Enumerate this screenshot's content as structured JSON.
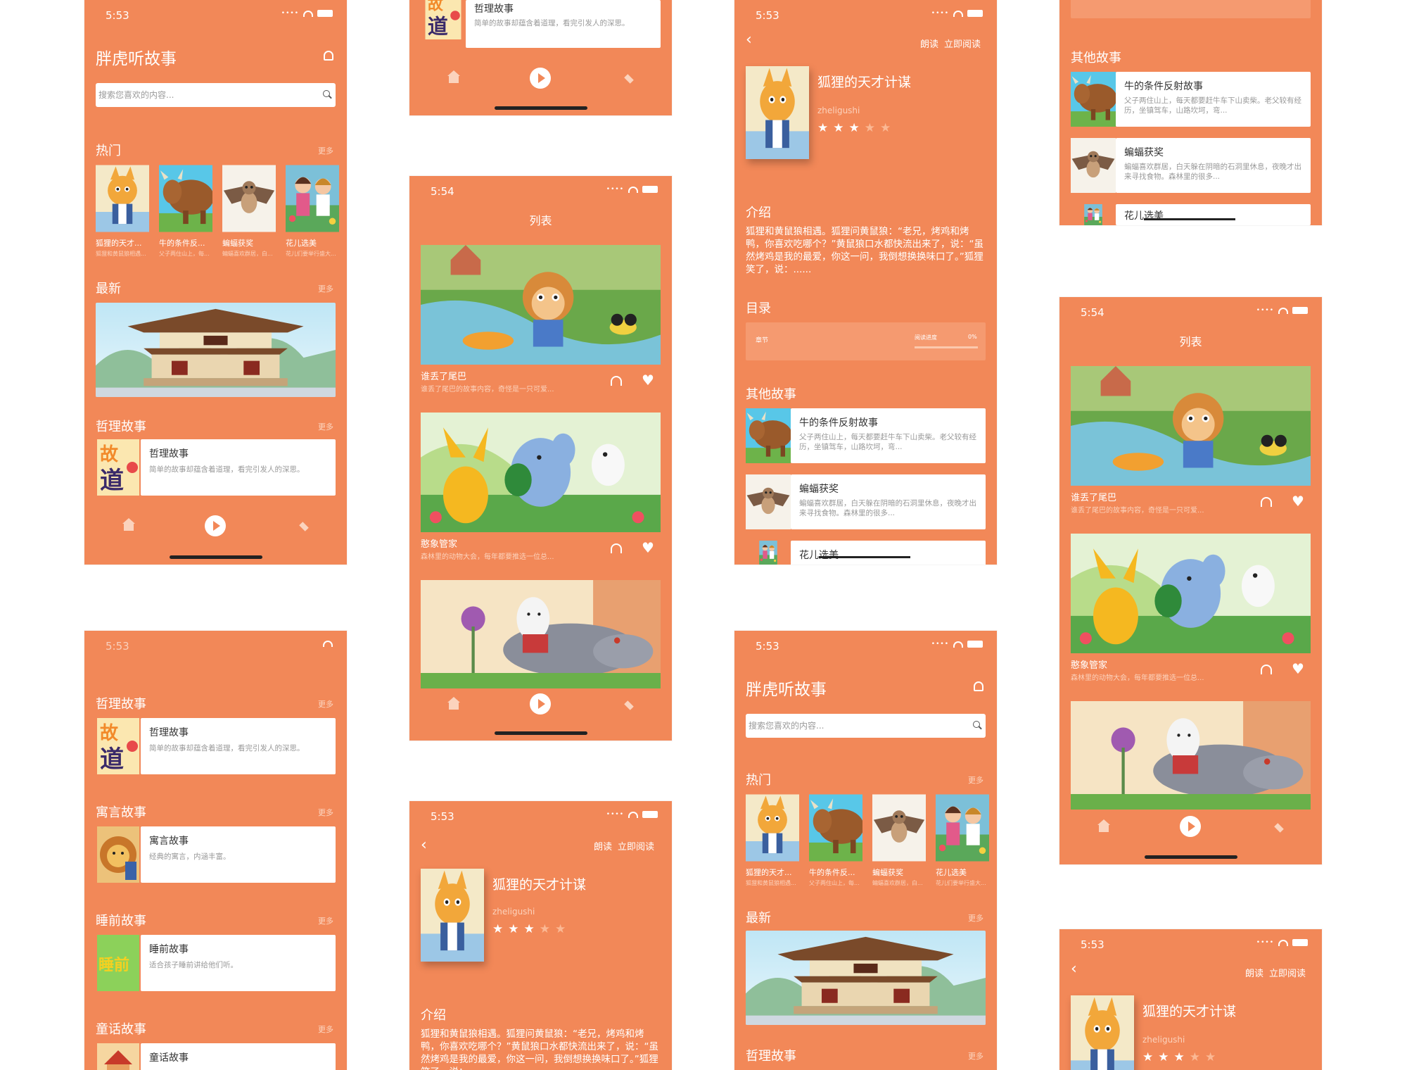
{
  "status": {
    "time_a": "5:53",
    "time_b": "5:54"
  },
  "app": {
    "title": "胖虎听故事",
    "search_placeholder": "搜索您喜欢的内容..."
  },
  "sections": {
    "hot": "热门",
    "latest": "最新",
    "philosophy": "哲理故事",
    "fable": "寓言故事",
    "bedtime": "睡前故事",
    "fairy": "童话故事",
    "more": "更多",
    "intro": "介绍",
    "toc": "目录",
    "other": "其他故事"
  },
  "hot_items": [
    {
      "title": "狐狸的天才...",
      "sub": "狐狸和黄鼠狼相遇..."
    },
    {
      "title": "牛的条件反...",
      "sub": "父子两住山上，每..."
    },
    {
      "title": "蝙蝠获奖",
      "sub": "蝙蝠喜欢群居，白..."
    },
    {
      "title": "花儿选美",
      "sub": "花儿们要举行盛大..."
    }
  ],
  "category_cards": {
    "philosophy": {
      "title": "哲理故事",
      "desc": "简单的故事却蕴含着道理，看完引发人的深思。"
    },
    "fable": {
      "title": "寓言故事",
      "desc": "经典的寓言，内涵丰富。"
    },
    "bedtime": {
      "title": "睡前故事",
      "desc": "适合孩子睡前讲给他们听。"
    },
    "fairy": {
      "title": "童话故事",
      "desc": ""
    }
  },
  "list": {
    "title": "列表",
    "items": [
      {
        "title": "谁丢了尾巴",
        "sub": "谁丢了尾巴的故事内容，奇怪是一只可爱..."
      },
      {
        "title": "憨象管家",
        "sub": "森林里的动物大会，每年都要推选一位总..."
      }
    ]
  },
  "detail": {
    "read_aloud": "朗读",
    "read_now": "立即阅读",
    "book_title": "狐狸的天才计谋",
    "author": "zheligushi",
    "rating": 3,
    "rating_max": 5,
    "intro_text": "狐狸和黄鼠狼相遇。狐狸问黄鼠狼：“老兄，烤鸡和烤鸭，你喜欢吃哪个？”黄鼠狼口水都快流出来了，说：“虽然烤鸡是我的最爱，你这一问，我倒想换换味口了。”狐狸笑了，说：......",
    "chapter": "章节",
    "progress_label": "阅读进度",
    "progress_value": "0%",
    "progress": 0
  },
  "other_stories": [
    {
      "title": "牛的条件反射故事",
      "desc": "父子两住山上，每天都要赶牛车下山卖柴。老父较有经历，坐镇驾车，山路坎坷，弯..."
    },
    {
      "title": "蝙蝠获奖",
      "desc": "蝙蝠喜欢群居，白天躲在阴暗的石洞里休息，夜晚才出来寻找食物。森林里的很多..."
    },
    {
      "title": "花儿选美",
      "desc": ""
    }
  ]
}
